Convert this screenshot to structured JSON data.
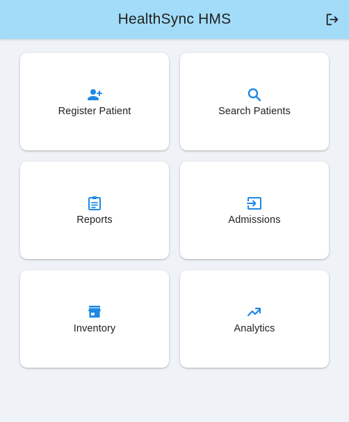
{
  "app": {
    "title": "HealthSync HMS"
  },
  "colors": {
    "appbar": "#a3dcf8",
    "background": "#eff3f8",
    "accent": "#1e88e5",
    "card": "#ffffff"
  },
  "actions": [
    {
      "label": "Register Patient",
      "icon": "person-add-icon"
    },
    {
      "label": "Search Patients",
      "icon": "search-icon"
    },
    {
      "label": "Reports",
      "icon": "clipboard-icon"
    },
    {
      "label": "Admissions",
      "icon": "login-icon"
    },
    {
      "label": "Inventory",
      "icon": "store-icon"
    },
    {
      "label": "Analytics",
      "icon": "trending-up-icon"
    }
  ]
}
